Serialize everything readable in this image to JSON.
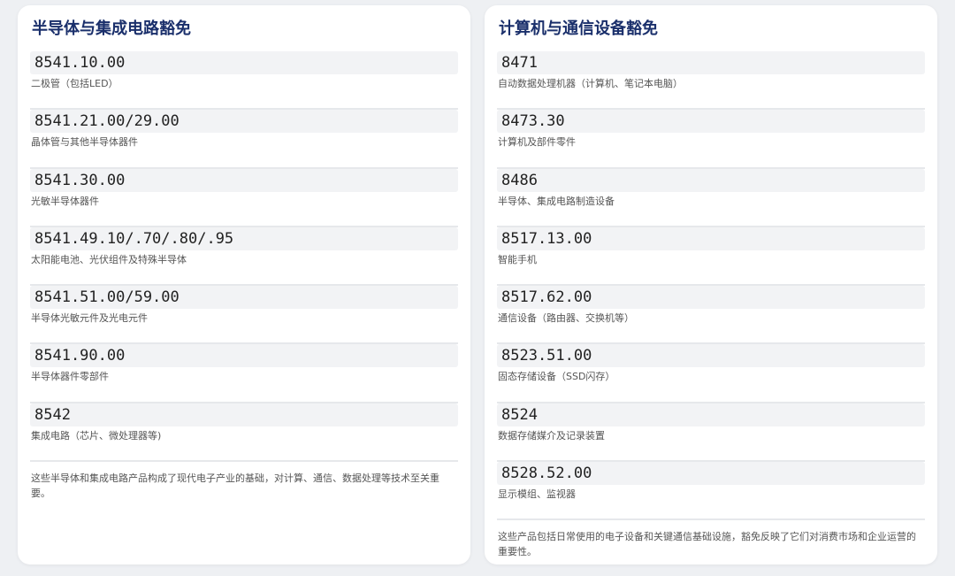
{
  "left": {
    "title": "半导体与集成电路豁免",
    "items": [
      {
        "code": "8541.10.00",
        "desc": "二极管（包括LED）"
      },
      {
        "code": "8541.21.00/29.00",
        "desc": "晶体管与其他半导体器件"
      },
      {
        "code": "8541.30.00",
        "desc": "光敏半导体器件"
      },
      {
        "code": "8541.49.10/.70/.80/.95",
        "desc": "太阳能电池、光伏组件及特殊半导体"
      },
      {
        "code": "8541.51.00/59.00",
        "desc": "半导体光敏元件及光电元件"
      },
      {
        "code": "8541.90.00",
        "desc": "半导体器件零部件"
      },
      {
        "code": "8542",
        "desc": "集成电路（芯片、微处理器等)"
      }
    ],
    "note": "这些半导体和集成电路产品构成了现代电子产业的基础，对计算、通信、数据处理等技术至关重要。"
  },
  "right": {
    "title": "计算机与通信设备豁免",
    "items": [
      {
        "code": "8471",
        "desc": "自动数据处理机器（计算机、笔记本电脑）"
      },
      {
        "code": "8473.30",
        "desc": "计算机及部件零件"
      },
      {
        "code": "8486",
        "desc": "半导体、集成电路制造设备"
      },
      {
        "code": "8517.13.00",
        "desc": "智能手机"
      },
      {
        "code": "8517.62.00",
        "desc": "通信设备（路由器、交换机等）"
      },
      {
        "code": "8523.51.00",
        "desc": "固态存储设备（SSD闪存）"
      },
      {
        "code": "8524",
        "desc": "数据存储媒介及记录装置"
      },
      {
        "code": "8528.52.00",
        "desc": "显示模组、监视器"
      }
    ],
    "note": "这些产品包括日常使用的电子设备和关键通信基础设施，豁免反映了它们对消费市场和企业运营的重要性。"
  }
}
